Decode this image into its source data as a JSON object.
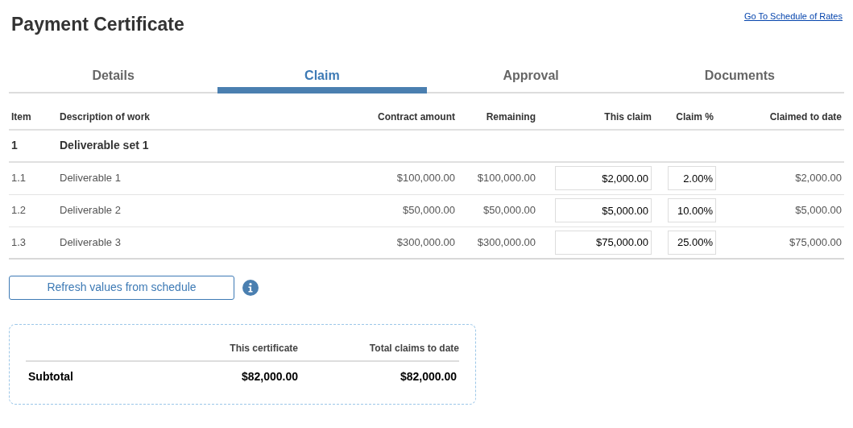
{
  "title": "Payment Certificate",
  "link": "Go To Schedule of Rates",
  "tabs": [
    {
      "label": "Details",
      "selected": false
    },
    {
      "label": "Claim",
      "selected": true
    },
    {
      "label": "Approval",
      "selected": false
    },
    {
      "label": "Documents",
      "selected": false
    }
  ],
  "table": {
    "columns": [
      "Item",
      "Description of work",
      "Contract amount",
      "Remaining",
      "This claim",
      "Claim %",
      "Claimed to date"
    ],
    "rows": [
      {
        "kind": "group",
        "item": "1",
        "description": "Deliverable set 1"
      },
      {
        "kind": "line",
        "item": "1.1",
        "description": "Deliverable 1",
        "contract_amount": "$100,000.00",
        "remaining": "$100,000.00",
        "this_claim": "$2,000.00",
        "claim_percent": "2.00%",
        "claimed_to_date": "$2,000.00"
      },
      {
        "kind": "line",
        "item": "1.2",
        "description": "Deliverable 2",
        "contract_amount": "$50,000.00",
        "remaining": "$50,000.00",
        "this_claim": "$5,000.00",
        "claim_percent": "10.00%",
        "claimed_to_date": "$5,000.00"
      },
      {
        "kind": "line",
        "item": "1.3",
        "description": "Deliverable 3",
        "contract_amount": "$300,000.00",
        "remaining": "$300,000.00",
        "this_claim": "$75,000.00",
        "claim_percent": "25.00%",
        "claimed_to_date": "$75,000.00"
      }
    ]
  },
  "refresh_button": "Refresh values from schedule",
  "summary": {
    "columns": [
      "This certificate",
      "Total claims to date"
    ],
    "rows": [
      {
        "label": "Subtotal",
        "this_certificate": "$82,000.00",
        "total_claims_to_date": "$82,000.00"
      }
    ]
  }
}
